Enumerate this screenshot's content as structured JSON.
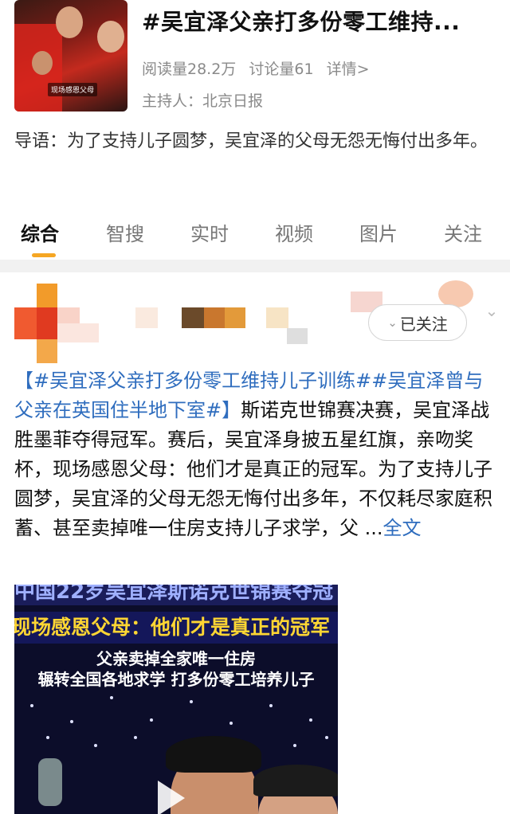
{
  "topic": {
    "title": "#吴宜泽父亲打多份零工维持...",
    "cover_caption": "现场感恩父母",
    "reads": "阅读量28.2万",
    "discussions": "讨论量61",
    "details": "详情>",
    "host": "主持人：北京日报"
  },
  "lead": "导语：为了支持儿子圆梦，吴宜泽的父母无怨无悔付出多年。",
  "tabs": [
    {
      "label": "综合",
      "active": true
    },
    {
      "label": "智搜"
    },
    {
      "label": "实时"
    },
    {
      "label": "视频"
    },
    {
      "label": "图片"
    },
    {
      "label": "关注"
    }
  ],
  "post": {
    "follow_label": "已关注",
    "topic_tags": "【#吴宜泽父亲打多份零工维持儿子训练##吴宜泽曾与父亲在英国住半地下室#】",
    "text": "斯诺克世锦赛决赛，吴宜泽战胜墨菲夺得冠军。赛后，吴宜泽身披五星红旗，亲吻奖杯，现场感恩父母：他们才是真正的冠军。为了支持儿子圆梦，吴宜泽的父母无怨无悔付出多年，不仅耗尽家庭积蓄、甚至卖掉唯一住房支持儿子求学，父 ...",
    "full_text_link": "全文",
    "video": {
      "line1": "中国22岁吴宜泽斯诺克世锦赛夺冠",
      "line2": "现场感恩父母：他们才是真正的冠军",
      "line3": "父亲卖掉全家唯一住房",
      "line4": "辗转全国各地求学 打多份零工培养儿子"
    }
  },
  "colors": {
    "accent": "#f5a623",
    "link": "#2f6dbe",
    "muted": "#8a8a8a"
  }
}
